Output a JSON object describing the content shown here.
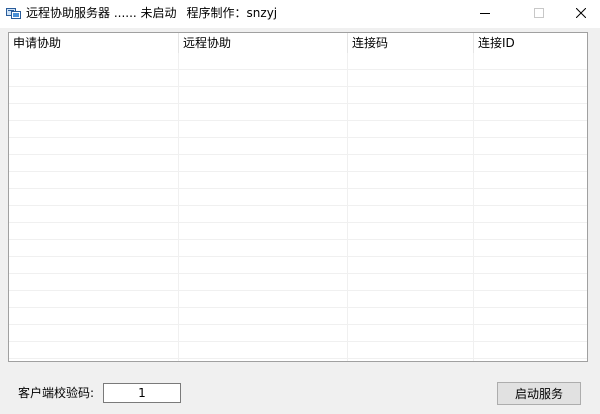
{
  "window": {
    "title": "远程协助服务器 ...... 未启动",
    "author": "程序制作：snzyj",
    "icon": "remote-assist-app-icon",
    "controls": {
      "minimize_icon": "minimize-icon",
      "maximize_icon": "maximize-icon",
      "close_icon": "close-icon"
    }
  },
  "list": {
    "columns": [
      "申请协助",
      "远程协助",
      "连接码",
      "连接ID"
    ],
    "rows": []
  },
  "footer": {
    "code_label": "客户端校验码:",
    "code_value": "1",
    "start_button": "启动服务"
  },
  "colors": {
    "titlebar_bg": "#ffffff",
    "window_bg": "#f0f0f0",
    "list_border": "#a0a0a0",
    "button_bg": "#e1e1e1"
  }
}
